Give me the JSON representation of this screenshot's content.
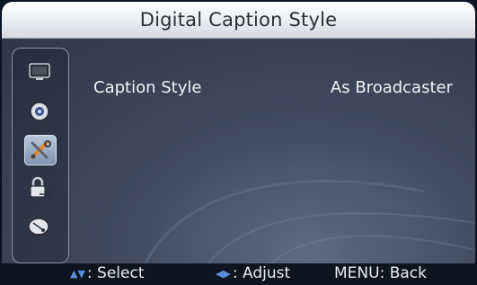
{
  "header": {
    "title": "Digital Caption Style"
  },
  "sidebar": {
    "items": [
      {
        "icon": "tv-picture-icon",
        "active": false
      },
      {
        "icon": "audio-speaker-icon",
        "active": false
      },
      {
        "icon": "settings-tools-icon",
        "active": true
      },
      {
        "icon": "lock-key-icon",
        "active": false
      },
      {
        "icon": "satellite-dish-icon",
        "active": false
      }
    ]
  },
  "menu": {
    "rows": [
      {
        "label": "Caption Style",
        "value": "As Broadcaster"
      }
    ]
  },
  "footer": {
    "select": ": Select",
    "adjust": ": Adjust",
    "back": "MENU: Back"
  },
  "colors": {
    "accent_arrow": "#5a8fd8",
    "background": "#3b4556"
  }
}
